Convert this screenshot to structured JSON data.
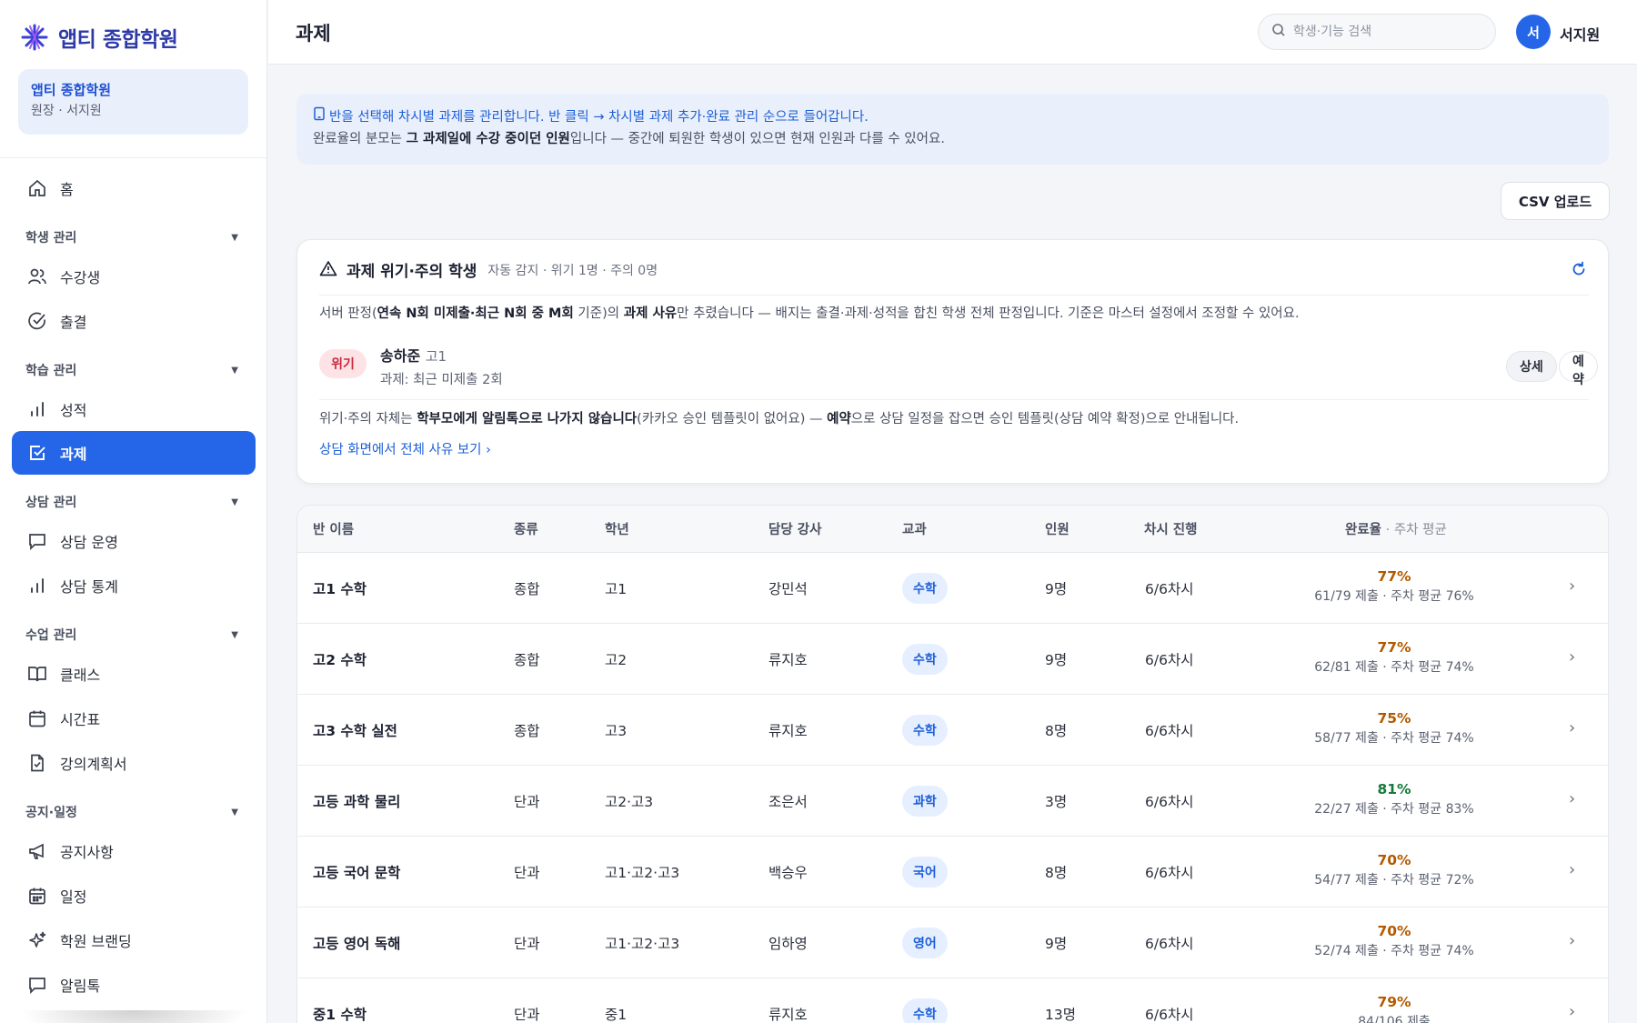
{
  "app": {
    "brand": "앱티 종합학원",
    "page_title": "과제"
  },
  "org_card": {
    "name": "앱티 종합학원",
    "role": "원장 · 서지원"
  },
  "search": {
    "placeholder": "학생·기능 검색"
  },
  "user": {
    "initial": "서",
    "name": "서지원"
  },
  "sidebar": {
    "home": "홈",
    "groups": {
      "students": "학생 관리",
      "learning": "학습 관리",
      "counsel": "상담 관리",
      "classes": "수업 관리",
      "notice": "공지·일정"
    },
    "items": {
      "enrollees": "수강생",
      "attendance": "출결",
      "grades": "성적",
      "homework": "과제",
      "counsel_ops": "상담 운영",
      "counsel_stats": "상담 통계",
      "classes": "클래스",
      "timetable": "시간표",
      "syllabus": "강의계획서",
      "notices": "공지사항",
      "schedule": "일정",
      "branding": "학원 브랜딩",
      "alimtalk": "알림톡"
    }
  },
  "info": {
    "line1": "반을 선택해 차시별 과제를 관리합니다. 반 클릭 → 차시별 과제 추가·완료 관리 순으로 들어갑니다.",
    "line2_a": "완료율의 분모는 ",
    "line2_b": "그 과제일에 수강 중이던 인원",
    "line2_c": "입니다 — 중간에 퇴원한 학생이 있으면 현재 인원과 다를 수 있어요."
  },
  "csv_button": "CSV 업로드",
  "risk": {
    "title": "과제 위기·주의 학생",
    "subtitle": "자동 감지 · 위기 1명 · 주의 0명",
    "desc_a": "서버 판정(",
    "desc_b": "연속 N회 미제출·최근 N회 중 M회",
    "desc_c": " 기준)의 ",
    "desc_d": "과제 사유",
    "desc_e": "만 추렸습니다 — 배지는 출결·과제·성적을 합친 학생 전체 판정입니다. 기준은 마스터 설정에서 조정할 수 있어요.",
    "student": {
      "badge": "위기",
      "name": "송하준",
      "grade": "고1",
      "reason": "과제: 최근 미제출 2회"
    },
    "detail_button": "상세",
    "reserve_button": "예약",
    "note_a": "위기·주의 자체는 ",
    "note_b": "학부모에게 알림톡으로 나가지 않습니다",
    "note_c": "(카카오 승인 템플릿이 없어요) — ",
    "note_d": "예약",
    "note_e": "으로 상담 일정을 잡으면 승인 템플릿(상담 예약 확정)으로 안내됩니다.",
    "link": "상담 화면에서 전체 사유 보기 ›"
  },
  "table": {
    "headers": {
      "name": "반 이름",
      "type": "종류",
      "grade": "학년",
      "teacher": "담당 강사",
      "subject": "교과",
      "count": "인원",
      "progress": "차시 진행",
      "rate": "완료율",
      "rate_muted": " · 주차 평균"
    },
    "rows": [
      {
        "name": "고1 수학",
        "type": "종합",
        "grade": "고1",
        "teacher": "강민석",
        "subject": "수학",
        "subject_color": "#1d5fd8",
        "subject_bg": "#e6efff",
        "count": "9명",
        "progress": "6/6차시",
        "rate": "77%",
        "rate_color": "#b35a00",
        "rate_sub": "61/79 제출 · 주차 평균 76%"
      },
      {
        "name": "고2 수학",
        "type": "종합",
        "grade": "고2",
        "teacher": "류지호",
        "subject": "수학",
        "subject_color": "#1d5fd8",
        "subject_bg": "#e6efff",
        "count": "9명",
        "progress": "6/6차시",
        "rate": "77%",
        "rate_color": "#b35a00",
        "rate_sub": "62/81 제출 · 주차 평균 74%"
      },
      {
        "name": "고3 수학 실전",
        "type": "종합",
        "grade": "고3",
        "teacher": "류지호",
        "subject": "수학",
        "subject_color": "#1d5fd8",
        "subject_bg": "#e6efff",
        "count": "8명",
        "progress": "6/6차시",
        "rate": "75%",
        "rate_color": "#b35a00",
        "rate_sub": "58/77 제출 · 주차 평균 74%"
      },
      {
        "name": "고등 과학 물리",
        "type": "단과",
        "grade": "고2·고3",
        "teacher": "조은서",
        "subject": "과학",
        "subject_color": "#1d5fd8",
        "subject_bg": "#e6efff",
        "count": "3명",
        "progress": "6/6차시",
        "rate": "81%",
        "rate_color": "#157a3c",
        "rate_sub": "22/27 제출 · 주차 평균 83%"
      },
      {
        "name": "고등 국어 문학",
        "type": "단과",
        "grade": "고1·고2·고3",
        "teacher": "백승우",
        "subject": "국어",
        "subject_color": "#1d5fd8",
        "subject_bg": "#e6efff",
        "count": "8명",
        "progress": "6/6차시",
        "rate": "70%",
        "rate_color": "#b35a00",
        "rate_sub": "54/77 제출 · 주차 평균 72%"
      },
      {
        "name": "고등 영어 독해",
        "type": "단과",
        "grade": "고1·고2·고3",
        "teacher": "임하영",
        "subject": "영어",
        "subject_color": "#1d5fd8",
        "subject_bg": "#e6efff",
        "count": "9명",
        "progress": "6/6차시",
        "rate": "70%",
        "rate_color": "#b35a00",
        "rate_sub": "52/74 제출 · 주차 평균 74%"
      },
      {
        "name": "중1 수학",
        "type": "단과",
        "grade": "중1",
        "teacher": "류지호",
        "subject": "수학",
        "subject_color": "#1d5fd8",
        "subject_bg": "#e6efff",
        "count": "13명",
        "progress": "6/6차시",
        "rate": "79%",
        "rate_color": "#b35a00",
        "rate_sub": "84/106 제출"
      }
    ]
  },
  "colors": {
    "accent": "#2566e8",
    "risk": "#c8283c",
    "info_bg": "#e9f0fc"
  }
}
